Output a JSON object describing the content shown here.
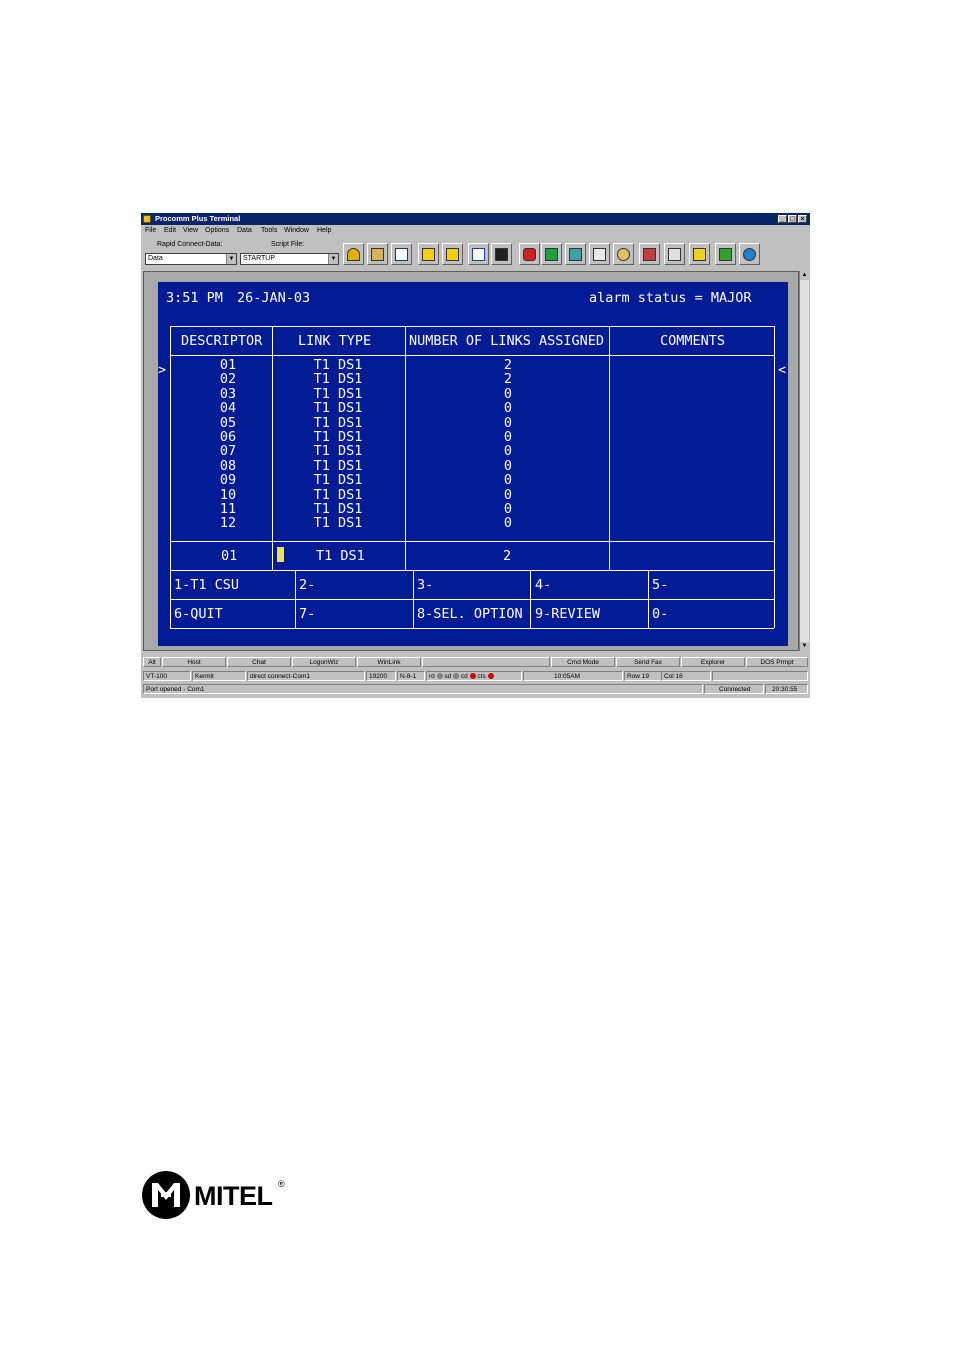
{
  "window": {
    "title": "Procomm Plus Terminal",
    "controls": [
      "_",
      "□",
      "×"
    ]
  },
  "menu": [
    "File",
    "Edit",
    "View",
    "Options",
    "Data",
    "Tools",
    "Window",
    "Help"
  ],
  "toolbar": {
    "rapid_connect_label": "Rapid Connect-Data:",
    "rapid_connect_value": "Data",
    "script_file_label": "Script File:",
    "script_file_value": "STARTUP"
  },
  "toolbar_icons": [
    "script-run-icon",
    "phone-book-icon",
    "mode-icon",
    "send-file-icon",
    "receive-file-icon",
    "capture-icon",
    "screen-icon",
    "meta-icon",
    "monitor-icon",
    "pencil-icon",
    "printer-icon",
    "globe-icon",
    "clear-icon",
    "keyboard-icon",
    "card-icon",
    "calc-icon",
    "web-globe-icon"
  ],
  "terminal": {
    "time": "3:51 PM",
    "date": "26-JAN-03",
    "alarm": "alarm status = MAJOR",
    "headers": [
      "DESCRIPTOR",
      "LINK TYPE",
      "NUMBER OF LINKS ASSIGNED",
      "COMMENTS"
    ],
    "left_marker": ">",
    "right_marker": "<",
    "rows": [
      {
        "descriptor": "01",
        "link_type": "T1 DS1",
        "links": "2"
      },
      {
        "descriptor": "02",
        "link_type": "T1 DS1",
        "links": "2"
      },
      {
        "descriptor": "03",
        "link_type": "T1 DS1",
        "links": "0"
      },
      {
        "descriptor": "04",
        "link_type": "T1 DS1",
        "links": "0"
      },
      {
        "descriptor": "05",
        "link_type": "T1 DS1",
        "links": "0"
      },
      {
        "descriptor": "06",
        "link_type": "T1 DS1",
        "links": "0"
      },
      {
        "descriptor": "07",
        "link_type": "T1 DS1",
        "links": "0"
      },
      {
        "descriptor": "08",
        "link_type": "T1 DS1",
        "links": "0"
      },
      {
        "descriptor": "09",
        "link_type": "T1 DS1",
        "links": "0"
      },
      {
        "descriptor": "10",
        "link_type": "T1 DS1",
        "links": "0"
      },
      {
        "descriptor": "11",
        "link_type": "T1 DS1",
        "links": "0"
      },
      {
        "descriptor": "12",
        "link_type": "T1 DS1",
        "links": "0"
      }
    ],
    "edit_row": {
      "descriptor": "01",
      "link_type": "T1 DS1",
      "links": "2",
      "comments": ""
    },
    "softkeys": [
      "1-T1 CSU",
      "2-",
      "3-",
      "4-",
      "5-",
      "6-QUIT",
      "7-",
      "8-SEL. OPTION",
      "9-REVIEW",
      "0-"
    ]
  },
  "actionbar": [
    "Alt",
    "Host",
    "Chat",
    "LogonWiz",
    "WinLink",
    "",
    "Cmd Mode",
    "Send Fax",
    "Explorer",
    "DOS Prmpt"
  ],
  "statusbar": {
    "emulation": "VT-100",
    "transfer": "Kermit",
    "connection": "direct connect-Com1",
    "baud": "19200",
    "parity": "N-8-1",
    "indicators": [
      "rd",
      "sd",
      "cd",
      "cts"
    ],
    "indicator_colors": [
      "#808080",
      "#808080",
      "#d00000",
      "#d00000"
    ],
    "time": "10:05AM",
    "row": "Row 19",
    "col": "Col 16"
  },
  "msgbar": {
    "message": "Port opened - Com1",
    "state": "Connected",
    "clock": "20:30:55"
  },
  "logo": {
    "text": "MITEL",
    "mark": "®"
  }
}
